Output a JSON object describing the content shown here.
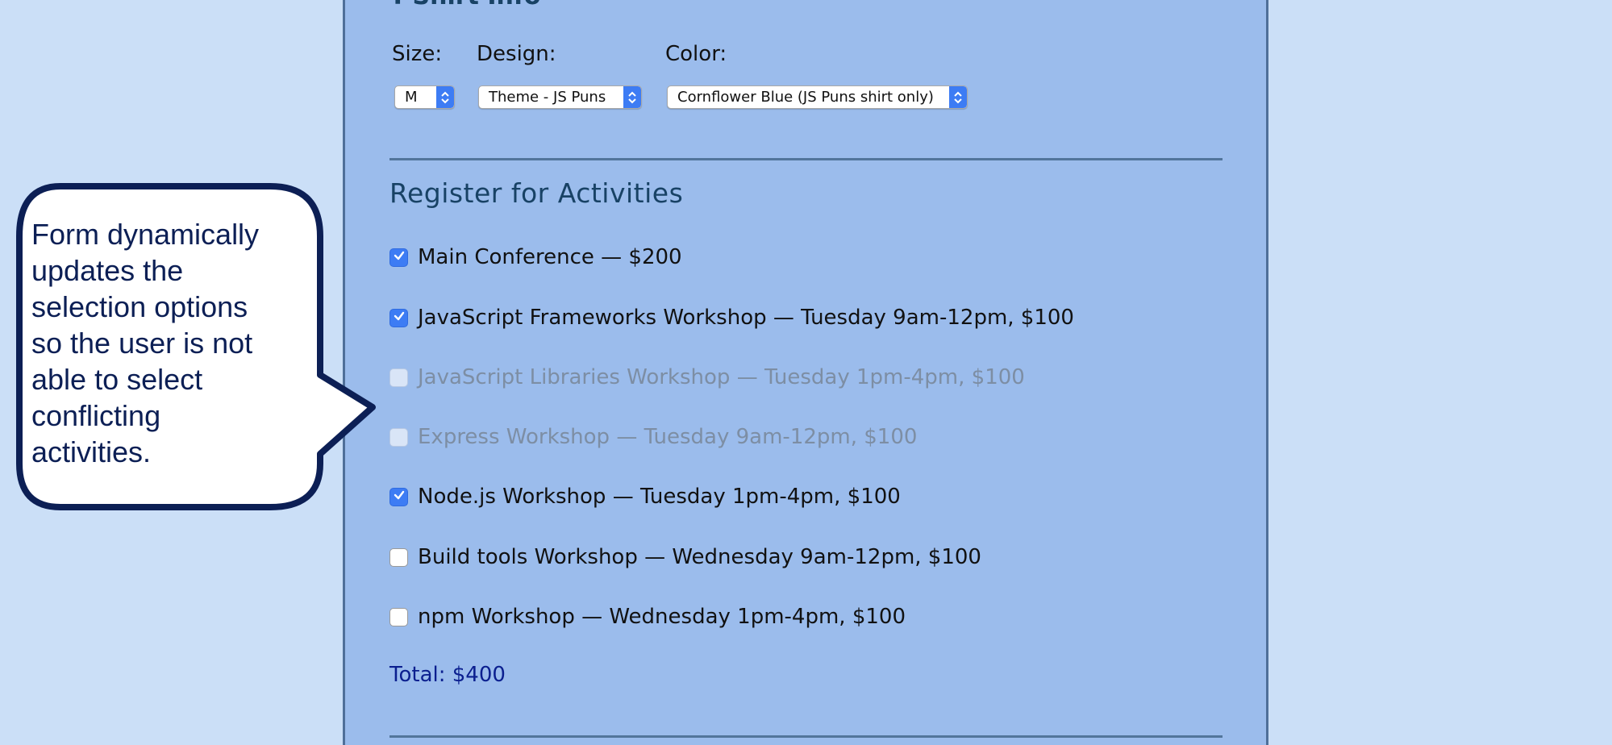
{
  "section_heading_partial": "T-Shirt Info",
  "tshirt": {
    "size_label": "Size:",
    "design_label": "Design:",
    "color_label": "Color:",
    "size_value": "M",
    "design_value": "Theme - JS Puns",
    "color_value": "Cornflower Blue (JS Puns shirt only)"
  },
  "activities": {
    "title": "Register for Activities",
    "items": [
      {
        "label": "Main Conference — $200",
        "checked": true,
        "disabled": false
      },
      {
        "label": "JavaScript Frameworks Workshop — Tuesday 9am-12pm, $100",
        "checked": true,
        "disabled": false
      },
      {
        "label": "JavaScript Libraries Workshop — Tuesday 1pm-4pm, $100",
        "checked": false,
        "disabled": true
      },
      {
        "label": "Express Workshop — Tuesday 9am-12pm, $100",
        "checked": false,
        "disabled": true
      },
      {
        "label": "Node.js Workshop — Tuesday 1pm-4pm, $100",
        "checked": true,
        "disabled": false
      },
      {
        "label": "Build tools Workshop — Wednesday 9am-12pm, $100",
        "checked": false,
        "disabled": false
      },
      {
        "label": "npm Workshop — Wednesday 1pm-4pm, $100",
        "checked": false,
        "disabled": false
      }
    ],
    "total": "Total: $400"
  },
  "callout": {
    "text": "Form dynamically\n updates the\n selection options\n so the user is not\n able to select\n conflicting\n activities."
  },
  "colors": {
    "page_background": "#cbdff7",
    "panel_background": "#9bbcec",
    "accent": "#3d7cf4",
    "heading": "#184265",
    "total": "#0b1f8f",
    "callout_border": "#0c1f55"
  },
  "icons": {
    "select_arrows": "chevron-up-down-icon",
    "check": "checkmark-icon",
    "callout": "speech-bubble-icon"
  }
}
